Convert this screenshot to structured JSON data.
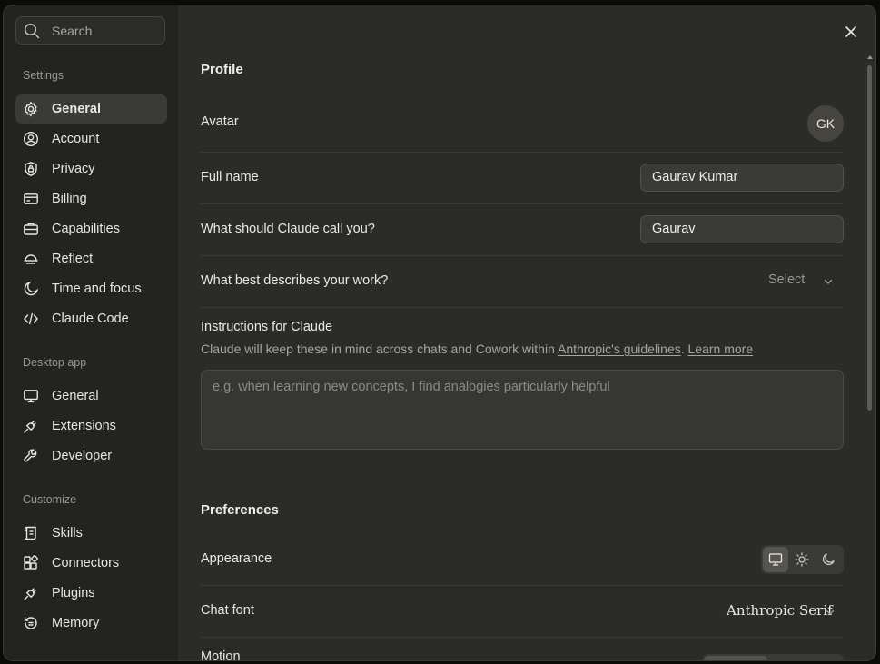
{
  "sidebar": {
    "search_placeholder": "Search",
    "sections": [
      {
        "label": "Settings"
      },
      {
        "label": "Desktop app"
      },
      {
        "label": "Customize"
      }
    ],
    "settings_items": [
      {
        "label": "General",
        "icon": "gear-icon",
        "active": true
      },
      {
        "label": "Account",
        "icon": "user-circle-icon"
      },
      {
        "label": "Privacy",
        "icon": "shield-lock-icon"
      },
      {
        "label": "Billing",
        "icon": "card-icon"
      },
      {
        "label": "Capabilities",
        "icon": "briefcase-icon"
      },
      {
        "label": "Reflect",
        "icon": "reflect-icon"
      },
      {
        "label": "Time and focus",
        "icon": "moon-icon"
      },
      {
        "label": "Claude Code",
        "icon": "code-icon"
      }
    ],
    "desktop_items": [
      {
        "label": "General",
        "icon": "monitor-icon"
      },
      {
        "label": "Extensions",
        "icon": "plug-icon"
      },
      {
        "label": "Developer",
        "icon": "wrench-icon"
      }
    ],
    "customize_items": [
      {
        "label": "Skills",
        "icon": "scroll-icon"
      },
      {
        "label": "Connectors",
        "icon": "blocks-icon"
      },
      {
        "label": "Plugins",
        "icon": "plug-icon"
      },
      {
        "label": "Memory",
        "icon": "history-icon"
      }
    ]
  },
  "profile": {
    "heading": "Profile",
    "avatar_label": "Avatar",
    "avatar_initials": "GK",
    "full_name_label": "Full name",
    "full_name_value": "Gaurav Kumar",
    "nickname_label": "What should Claude call you?",
    "nickname_value": "Gaurav",
    "work_label": "What best describes your work?",
    "work_select": "Select",
    "instructions_label": "Instructions for Claude",
    "instructions_sub_prefix": "Claude will keep these in mind across chats and Cowork within ",
    "instructions_link": "Anthropic's guidelines",
    "instructions_sub_sep": ". ",
    "learn_more": "Learn more",
    "instructions_placeholder": "e.g. when learning new concepts, I find analogies particularly helpful"
  },
  "preferences": {
    "heading": "Preferences",
    "appearance_label": "Appearance",
    "appearance_options": [
      "system",
      "light",
      "dark"
    ],
    "appearance_selected": "system",
    "chat_font_label": "Chat font",
    "chat_font_value": "Anthropic Serif",
    "motion_label": "Motion"
  }
}
